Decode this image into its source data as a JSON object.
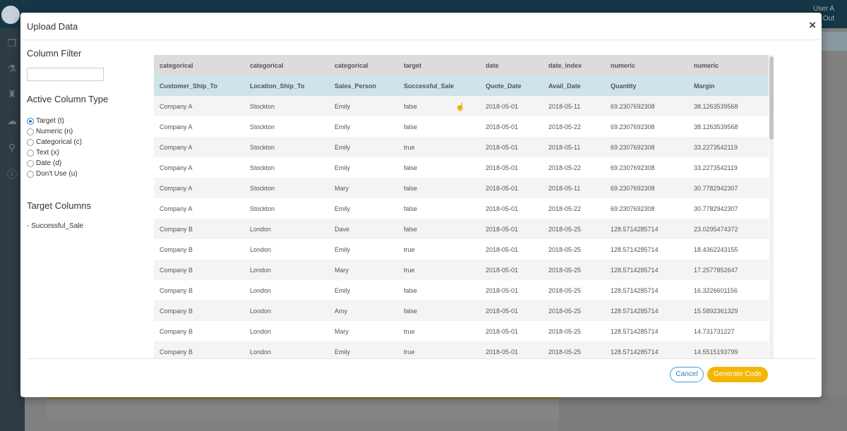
{
  "app": {
    "brand": "",
    "user_label": "User A",
    "logout_label": "Out"
  },
  "modal": {
    "title": "Upload Data",
    "close_label": "×"
  },
  "left_panel": {
    "column_filter_title": "Column Filter",
    "column_filter_value": "",
    "active_column_type_title": "Active Column Type",
    "column_types": [
      {
        "label": "Target (t)",
        "checked": true
      },
      {
        "label": "Numeric (n)",
        "checked": false
      },
      {
        "label": "Categorical (c)",
        "checked": false
      },
      {
        "label": "Text (x)",
        "checked": false
      },
      {
        "label": "Date (d)",
        "checked": false
      },
      {
        "label": "Don't Use (u)",
        "checked": false
      }
    ],
    "target_columns_title": "Target Columns",
    "target_columns": [
      "- Successful_Sale"
    ]
  },
  "table": {
    "types": [
      "categorical",
      "categorical",
      "categorical",
      "target",
      "date",
      "date_index",
      "numeric",
      "numeric"
    ],
    "columns": [
      "Customer_Ship_To",
      "Location_Ship_To",
      "Sales_Person",
      "Successful_Sale",
      "Quote_Date",
      "Avail_Date",
      "Quantity",
      "Margin"
    ],
    "rows": [
      [
        "Company A",
        "Stockton",
        "Emily",
        "false",
        "2018-05-01",
        "2018-05-11",
        "69.2307692308",
        "38.1263539568"
      ],
      [
        "Company A",
        "Stockton",
        "Emily",
        "false",
        "2018-05-01",
        "2018-05-22",
        "69.2307692308",
        "38.1263539568"
      ],
      [
        "Company A",
        "Stockton",
        "Emily",
        "true",
        "2018-05-01",
        "2018-05-11",
        "69.2307692308",
        "33.2273542119"
      ],
      [
        "Company A",
        "Stockton",
        "Emily",
        "false",
        "2018-05-01",
        "2018-05-22",
        "69.2307692308",
        "33.2273542119"
      ],
      [
        "Company A",
        "Stockton",
        "Mary",
        "false",
        "2018-05-01",
        "2018-05-11",
        "69.2307692308",
        "30.7782942307"
      ],
      [
        "Company A",
        "Stockton",
        "Emily",
        "false",
        "2018-05-01",
        "2018-05-22",
        "69.2307692308",
        "30.7782942307"
      ],
      [
        "Company B",
        "London",
        "Dave",
        "false",
        "2018-05-01",
        "2018-05-25",
        "128.5714285714",
        "23.0295474372"
      ],
      [
        "Company B",
        "London",
        "Emily",
        "true",
        "2018-05-01",
        "2018-05-25",
        "128.5714285714",
        "18.4362243155"
      ],
      [
        "Company B",
        "London",
        "Mary",
        "true",
        "2018-05-01",
        "2018-05-25",
        "128.5714285714",
        "17.2577852647"
      ],
      [
        "Company B",
        "London",
        "Emily",
        "false",
        "2018-05-01",
        "2018-05-25",
        "128.5714285714",
        "16.3226601156"
      ],
      [
        "Company B",
        "London",
        "Amy",
        "false",
        "2018-05-01",
        "2018-05-25",
        "128.5714285714",
        "15.5892361329"
      ],
      [
        "Company B",
        "London",
        "Mary",
        "true",
        "2018-05-01",
        "2018-05-25",
        "128.5714285714",
        "14.731731227"
      ],
      [
        "Company B",
        "London",
        "Emily",
        "true",
        "2018-05-01",
        "2018-05-25",
        "128.5714285714",
        "14.5515193799"
      ]
    ]
  },
  "footer": {
    "cancel_label": "Cancel",
    "generate_label": "Generate Code"
  },
  "colors": {
    "primary": "#2a7fd4",
    "accent_button": "#f2b705",
    "header_row": "#cfe3ea",
    "topbar": "#163746"
  }
}
